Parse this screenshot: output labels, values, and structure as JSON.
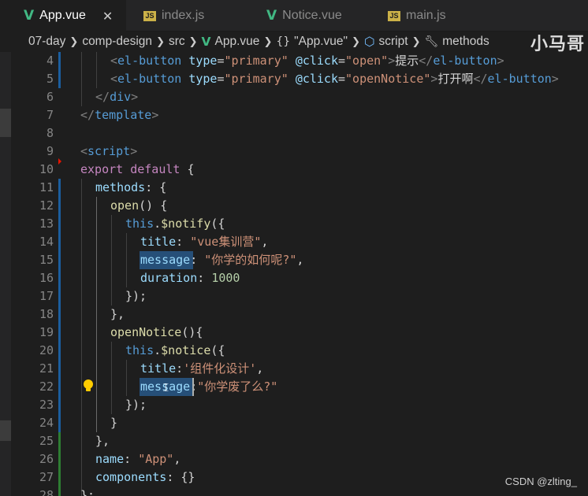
{
  "tabs": [
    {
      "label": "App.vue",
      "icon": "vue-file-icon",
      "active": true
    },
    {
      "label": "index.js",
      "icon": "js-file-icon",
      "active": false
    },
    {
      "label": "Notice.vue",
      "icon": "vue-file-icon",
      "active": false
    },
    {
      "label": "main.js",
      "icon": "js-file-icon",
      "active": false
    }
  ],
  "breadcrumb": {
    "items": [
      "07-day",
      "comp-design",
      "src",
      "App.vue",
      "\"App.vue\"",
      "script",
      "methods"
    ],
    "braces_icon": "{}",
    "watermark": "小马哥"
  },
  "colors": {
    "background": "#1e1e1e",
    "tag": "#569cd6",
    "attribute": "#9cdcfe",
    "string": "#ce9178",
    "keyword": "#c586c0",
    "function": "#dcdcaa",
    "number": "#b5cea8",
    "vue_green": "#41b883"
  },
  "lines": [
    {
      "n": "4",
      "tokens": [
        [
          "t-br",
          "<"
        ],
        [
          "t-tag",
          "el-button"
        ],
        [
          "t-txt",
          " "
        ],
        [
          "t-attr",
          "type"
        ],
        [
          "t-txt",
          "="
        ],
        [
          "t-str",
          "\"primary\""
        ],
        [
          "t-txt",
          " "
        ],
        [
          "t-attr",
          "@click"
        ],
        [
          "t-txt",
          "="
        ],
        [
          "t-str",
          "\"open\""
        ],
        [
          "t-br",
          ">"
        ],
        [
          "t-txt",
          "提示"
        ],
        [
          "t-br",
          "</"
        ],
        [
          "t-tag",
          "el-button"
        ],
        [
          "t-br",
          ">"
        ]
      ]
    },
    {
      "n": "5",
      "tokens": [
        [
          "t-br",
          "<"
        ],
        [
          "t-tag",
          "el-button"
        ],
        [
          "t-txt",
          " "
        ],
        [
          "t-attr",
          "type"
        ],
        [
          "t-txt",
          "="
        ],
        [
          "t-str",
          "\"primary\""
        ],
        [
          "t-txt",
          " "
        ],
        [
          "t-attr",
          "@click"
        ],
        [
          "t-txt",
          "="
        ],
        [
          "t-str",
          "\"openNotice\""
        ],
        [
          "t-br",
          ">"
        ],
        [
          "t-txt",
          "打开啊"
        ],
        [
          "t-br",
          "</"
        ],
        [
          "t-tag",
          "el-button"
        ],
        [
          "t-br",
          ">"
        ]
      ]
    },
    {
      "n": "6",
      "tokens": [
        [
          "t-br",
          "</"
        ],
        [
          "t-tag",
          "div"
        ],
        [
          "t-br",
          ">"
        ]
      ]
    },
    {
      "n": "7",
      "tokens": [
        [
          "t-br",
          "</"
        ],
        [
          "t-tag",
          "template"
        ],
        [
          "t-br",
          ">"
        ]
      ]
    },
    {
      "n": "8",
      "tokens": []
    },
    {
      "n": "9",
      "tokens": [
        [
          "t-br",
          "<"
        ],
        [
          "t-tag",
          "script"
        ],
        [
          "t-br",
          ">"
        ]
      ]
    },
    {
      "n": "10",
      "tokens": [
        [
          "t-kw",
          "export"
        ],
        [
          "t-txt",
          " "
        ],
        [
          "t-kw",
          "default"
        ],
        [
          "t-txt",
          " {"
        ]
      ]
    },
    {
      "n": "11",
      "tokens": [
        [
          "t-prop",
          "methods"
        ],
        [
          "t-txt",
          ": {"
        ]
      ]
    },
    {
      "n": "12",
      "tokens": [
        [
          "t-fn",
          "open"
        ],
        [
          "t-txt",
          "() {"
        ]
      ]
    },
    {
      "n": "13",
      "tokens": [
        [
          "t-this",
          "this"
        ],
        [
          "t-txt",
          "."
        ],
        [
          "t-fn",
          "$notify"
        ],
        [
          "t-txt",
          "({"
        ]
      ]
    },
    {
      "n": "14",
      "tokens": [
        [
          "t-prop",
          "title"
        ],
        [
          "t-txt",
          ": "
        ],
        [
          "t-str",
          "\"vue集训营\""
        ],
        [
          "t-txt",
          ","
        ]
      ]
    },
    {
      "n": "15",
      "tokens": [
        [
          "t-prop",
          "message"
        ],
        [
          "t-txt",
          ": "
        ],
        [
          "t-str",
          "\"你学的如何呢?\""
        ],
        [
          "t-txt",
          ","
        ]
      ]
    },
    {
      "n": "16",
      "tokens": [
        [
          "t-prop",
          "duration"
        ],
        [
          "t-txt",
          ": "
        ],
        [
          "t-num",
          "1000"
        ]
      ]
    },
    {
      "n": "17",
      "tokens": [
        [
          "t-txt",
          "});"
        ]
      ]
    },
    {
      "n": "18",
      "tokens": [
        [
          "t-txt",
          "},"
        ]
      ]
    },
    {
      "n": "19",
      "tokens": [
        [
          "t-fn",
          "openNotice"
        ],
        [
          "t-txt",
          "(){"
        ]
      ]
    },
    {
      "n": "20",
      "tokens": [
        [
          "t-this",
          "this"
        ],
        [
          "t-txt",
          "."
        ],
        [
          "t-fn",
          "$notice"
        ],
        [
          "t-txt",
          "({"
        ]
      ]
    },
    {
      "n": "21",
      "tokens": [
        [
          "t-prop",
          "title"
        ],
        [
          "t-txt",
          ":"
        ],
        [
          "t-str",
          "'组件化设计'"
        ],
        [
          "t-txt",
          ","
        ]
      ]
    },
    {
      "n": "22",
      "tokens": [
        [
          "t-prop",
          "message"
        ],
        [
          "t-txt",
          ":"
        ],
        [
          "t-str",
          "\"你学废了么?\""
        ]
      ]
    },
    {
      "n": "23",
      "tokens": [
        [
          "t-txt",
          "});"
        ]
      ]
    },
    {
      "n": "24",
      "tokens": [
        [
          "t-txt",
          "}"
        ]
      ]
    },
    {
      "n": "25",
      "tokens": [
        [
          "t-txt",
          "},"
        ]
      ]
    },
    {
      "n": "26",
      "tokens": [
        [
          "t-prop",
          "name"
        ],
        [
          "t-txt",
          ": "
        ],
        [
          "t-str",
          "\"App\""
        ],
        [
          "t-txt",
          ","
        ]
      ]
    },
    {
      "n": "27",
      "tokens": [
        [
          "t-prop",
          "components"
        ],
        [
          "t-txt",
          ": {}"
        ]
      ]
    },
    {
      "n": "28",
      "tokens": [
        [
          "t-txt",
          "};"
        ]
      ]
    }
  ],
  "footer_watermark": "CSDN @zlting_"
}
